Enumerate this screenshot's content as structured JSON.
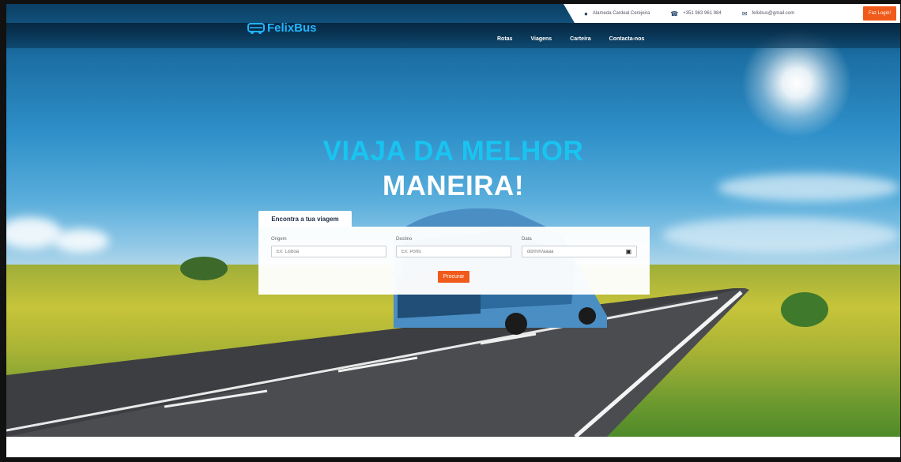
{
  "topbar": {
    "address": "Alameda Cardeal Cerejeira",
    "phone": "+351 963 961 984",
    "email": "felixbus@gmail.com",
    "login_label": "Faz Login!"
  },
  "brand": {
    "name": "FelixBus"
  },
  "nav": {
    "items": [
      "Rotas",
      "Viagens",
      "Carteira",
      "Contacta-nos"
    ]
  },
  "hero": {
    "line1": "VIAJA DA MELHOR",
    "line2": "MANEIRA!"
  },
  "search": {
    "tab_label": "Encontra a tua viagem",
    "origin_label": "Origem",
    "origin_placeholder": "Ex: Lisboa",
    "destination_label": "Destino",
    "destination_placeholder": "Ex: Porto",
    "date_label": "Data",
    "date_placeholder": "dd/mm/aaaa",
    "button_label": "Procurar"
  },
  "colors": {
    "accent": "#f05a1a",
    "brand": "#22b4ff",
    "headline_cyan": "#19c4f0"
  }
}
